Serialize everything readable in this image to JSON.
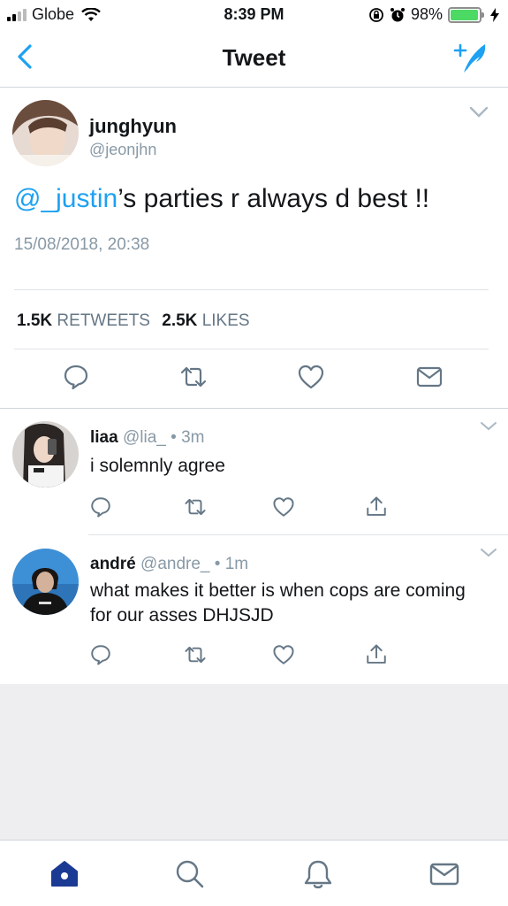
{
  "status_bar": {
    "carrier": "Globe",
    "time": "8:39 PM",
    "battery_percent": "98%",
    "battery_level": 0.98,
    "icons": [
      "signal-icon",
      "wifi-icon",
      "rotation-lock-icon",
      "alarm-icon",
      "battery-icon",
      "charging-icon"
    ]
  },
  "nav": {
    "title": "Tweet",
    "back_icon": "chevron-left-icon",
    "compose_icon": "compose-tweet-icon",
    "accent_color": "#1da1f2"
  },
  "main_tweet": {
    "name": "junghyun",
    "handle": "@jeonjhn",
    "mention": "@_justin",
    "text_after_mention": "’s parties r always d best !!",
    "date": "15/08/2018, 20:38",
    "retweets_count": "1.5K",
    "retweets_label": "RETWEETS",
    "likes_count": "2.5K",
    "likes_label": "LIKES",
    "actions": [
      "reply-icon",
      "retweet-icon",
      "like-icon",
      "message-icon"
    ]
  },
  "replies": [
    {
      "name": "liaa",
      "handle": "@lia_",
      "dot": "•",
      "time": "3m",
      "text": "i solemnly agree",
      "actions": [
        "reply-icon",
        "retweet-icon",
        "like-icon",
        "share-icon"
      ]
    },
    {
      "name": "andré",
      "handle": "@andre_",
      "dot": "•",
      "time": "1m",
      "text": "what makes it better is when cops are coming for our asses DHJSJD",
      "actions": [
        "reply-icon",
        "retweet-icon",
        "like-icon",
        "share-icon"
      ]
    }
  ],
  "tab_bar": {
    "tabs": [
      "home-icon",
      "search-icon",
      "notifications-icon",
      "messages-icon"
    ],
    "active_tab": "home-icon"
  }
}
